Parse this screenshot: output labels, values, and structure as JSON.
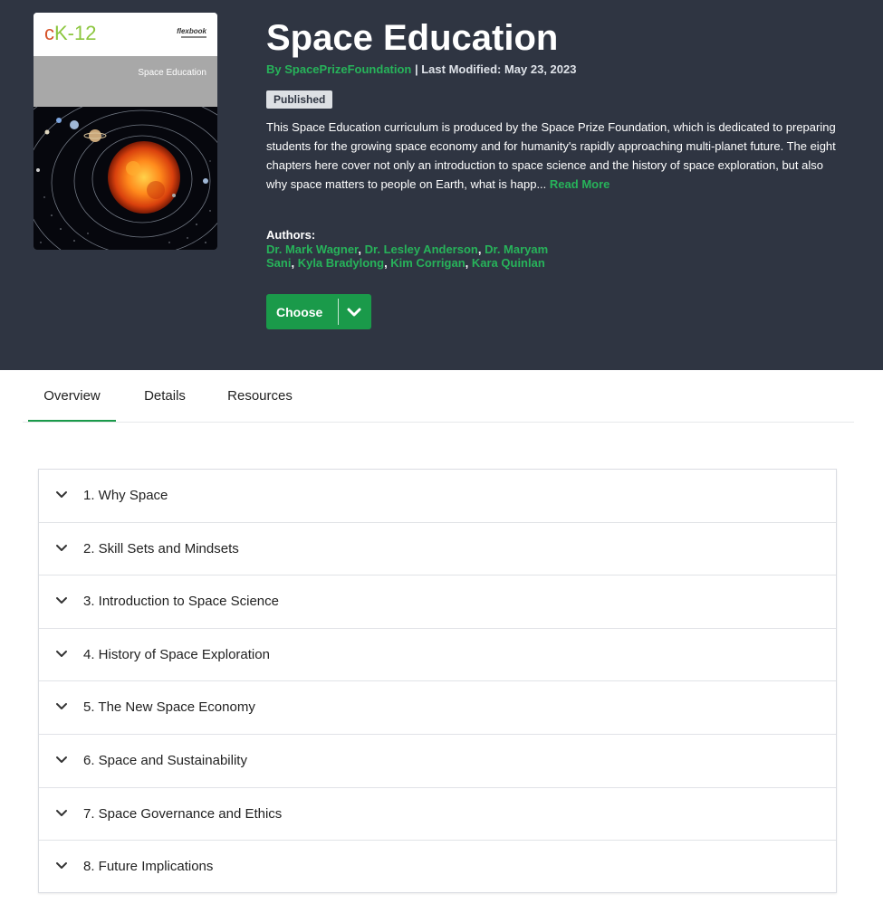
{
  "colors": {
    "hero_bg": "#2f3542",
    "accent_green": "#27b35a",
    "button_green": "#1a9a4a"
  },
  "cover": {
    "logo_c": "c",
    "logo_k": "K-12",
    "brand": "flexbook",
    "title": "Space Education"
  },
  "book": {
    "title": "Space Education",
    "by_prefix": "By ",
    "publisher": "SpacePrizeFoundation",
    "modified": " | Last Modified: May 23, 2023",
    "status": "Published",
    "description": "This Space Education curriculum is produced by the Space Prize Foundation, which is dedicated to preparing students for the growing space economy and for humanity's rapidly approaching multi-planet future. The eight chapters here cover not only an introduction to space science and the history of space exploration, but also why space matters to people on Earth, what is happ...",
    "read_more": "Read More",
    "authors_label": "Authors:",
    "authors": [
      "Dr. Mark Wagner",
      "Dr. Lesley Anderson",
      "Dr. Maryam Sani",
      "Kyla Bradylong",
      "Kim Corrigan",
      "Kara Quinlan"
    ],
    "separator": ", ",
    "choose_label": "Choose",
    "choose_dropdown_icon": "chevron-down-icon"
  },
  "tabs": [
    {
      "label": "Overview",
      "active": true
    },
    {
      "label": "Details",
      "active": false
    },
    {
      "label": "Resources",
      "active": false
    }
  ],
  "chapters": [
    "1. Why Space",
    "2. Skill Sets and Mindsets",
    "3. Introduction to Space Science",
    "4. History of Space Exploration",
    "5. The New Space Economy",
    "6. Space and Sustainability",
    "7. Space Governance and Ethics",
    "8. Future Implications"
  ]
}
